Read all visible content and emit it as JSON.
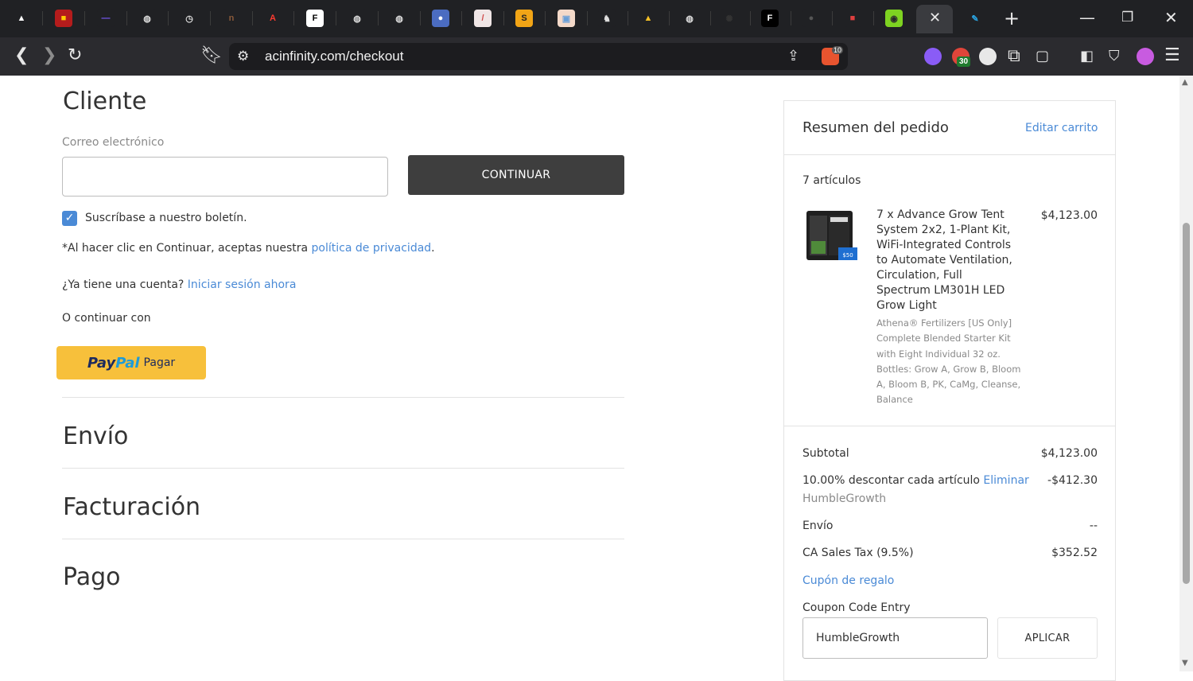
{
  "browser": {
    "url": "acinfinity.com/checkout",
    "tabs": [
      {
        "icon": "flame-icon",
        "color": "#ffffff",
        "bg": "#202124",
        "glyph": "▲"
      },
      {
        "icon": "ifixit-icon",
        "color": "#ffcc00",
        "bg": "#b51c1c",
        "glyph": "■"
      },
      {
        "icon": "dashes-icon",
        "color": "#7b5cff",
        "bg": "#202124",
        "glyph": "—"
      },
      {
        "icon": "globe-icon",
        "color": "#dddddd",
        "bg": "#202124",
        "glyph": "◍"
      },
      {
        "icon": "clock-icon",
        "color": "#dddddd",
        "bg": "#202124",
        "glyph": "◷"
      },
      {
        "icon": "n-icon",
        "color": "#8a5a3a",
        "bg": "#202124",
        "glyph": "n"
      },
      {
        "icon": "acrobat-icon",
        "color": "#ff3b30",
        "bg": "#202124",
        "glyph": "A"
      },
      {
        "icon": "fgc-icon",
        "color": "#000000",
        "bg": "#ffffff",
        "glyph": "F"
      },
      {
        "icon": "globe-icon",
        "color": "#dddddd",
        "bg": "#202124",
        "glyph": "◍"
      },
      {
        "icon": "globe-icon",
        "color": "#dddddd",
        "bg": "#202124",
        "glyph": "◍"
      },
      {
        "icon": "circle-blue-icon",
        "color": "#ffffff",
        "bg": "#4b6cc1",
        "glyph": "●"
      },
      {
        "icon": "slash-icon",
        "color": "#d04a4a",
        "bg": "#f0e6e6",
        "glyph": "/"
      },
      {
        "icon": "s-icon",
        "color": "#222222",
        "bg": "#f2a516",
        "glyph": "S"
      },
      {
        "icon": "window-icon",
        "color": "#6a9fd8",
        "bg": "#f4d9c9",
        "glyph": "▣"
      },
      {
        "icon": "wolf-icon",
        "color": "#dddddd",
        "bg": "#202124",
        "glyph": "♞"
      },
      {
        "icon": "drive-icon",
        "color": "#f6c026",
        "bg": "#202124",
        "glyph": "▲"
      },
      {
        "icon": "globe-icon",
        "color": "#dddddd",
        "bg": "#202124",
        "glyph": "◍"
      },
      {
        "icon": "sparkle-icon",
        "color": "#333333",
        "bg": "#202124",
        "glyph": "✺"
      },
      {
        "icon": "f-icon",
        "color": "#ffffff",
        "bg": "#000000",
        "glyph": "F"
      },
      {
        "icon": "dark-circle-icon",
        "color": "#555555",
        "bg": "#202124",
        "glyph": "●"
      },
      {
        "icon": "red-box-icon",
        "color": "#e04040",
        "bg": "#202124",
        "glyph": "■"
      },
      {
        "icon": "lime-icon",
        "color": "#2a2a2a",
        "bg": "#7ed321",
        "glyph": "◉"
      },
      {
        "icon": "pen-icon",
        "color": "#2aa3e0",
        "bg": "#202124",
        "glyph": "✎"
      }
    ],
    "active_tab_close": "✕",
    "new_tab": "+",
    "extension_badge": "30",
    "brave_badge": "10"
  },
  "customer": {
    "heading": "Cliente",
    "email_label": "Correo electrónico",
    "email_value": "",
    "continue_button": "CONTINUAR",
    "newsletter_label": "Suscríbase a nuestro boletín.",
    "newsletter_checked": true,
    "privacy_prefix": "*Al hacer clic en Continuar, aceptas nuestra ",
    "privacy_link": "política de privacidad",
    "privacy_suffix": ".",
    "account_prefix": "¿Ya tiene una cuenta? ",
    "login_link": "Iniciar sesión ahora",
    "or_continue": "O continuar con",
    "paypal_pay": "Pay",
    "paypal_pal": "Pal",
    "paypal_label": "Pagar"
  },
  "sections": {
    "shipping": "Envío",
    "billing": "Facturación",
    "payment": "Pago"
  },
  "summary": {
    "title": "Resumen del pedido",
    "edit_cart": "Editar carrito",
    "items_count": "7 artículos",
    "product_name": "7 x Advance Grow Tent System 2x2, 1-Plant Kit, WiFi-Integrated Controls to Automate Ventilation, Circulation, Full Spectrum LM301H LED Grow Light",
    "product_desc": "Athena® Fertilizers [US Only] Complete Blended Starter Kit with Eight Individual 32 oz. Bottles: Grow A, Grow B, Bloom A, Bloom B, PK, CaMg, Cleanse, Balance",
    "product_price": "$4,123.00",
    "product_img_badge": "$50",
    "subtotal_label": "Subtotal",
    "subtotal_value": "$4,123.00",
    "discount_label": "10.00% descontar cada artículo ",
    "discount_remove": "Eliminar",
    "discount_value": "-$412.30",
    "discount_code": "HumbleGrowth",
    "shipping_label": "Envío",
    "shipping_value": "--",
    "tax_label": "CA Sales Tax (9.5%)",
    "tax_value": "$352.52",
    "gift_link": "Cupón de regalo",
    "coupon_label": "Coupon Code Entry",
    "coupon_value": "HumbleGrowth",
    "apply_button": "APLICAR"
  },
  "colors": {
    "link": "#4a8ad6",
    "continue_bg": "#3e3e3e",
    "paypal_bg": "#f7c03b",
    "chrome_bg": "#202124"
  }
}
